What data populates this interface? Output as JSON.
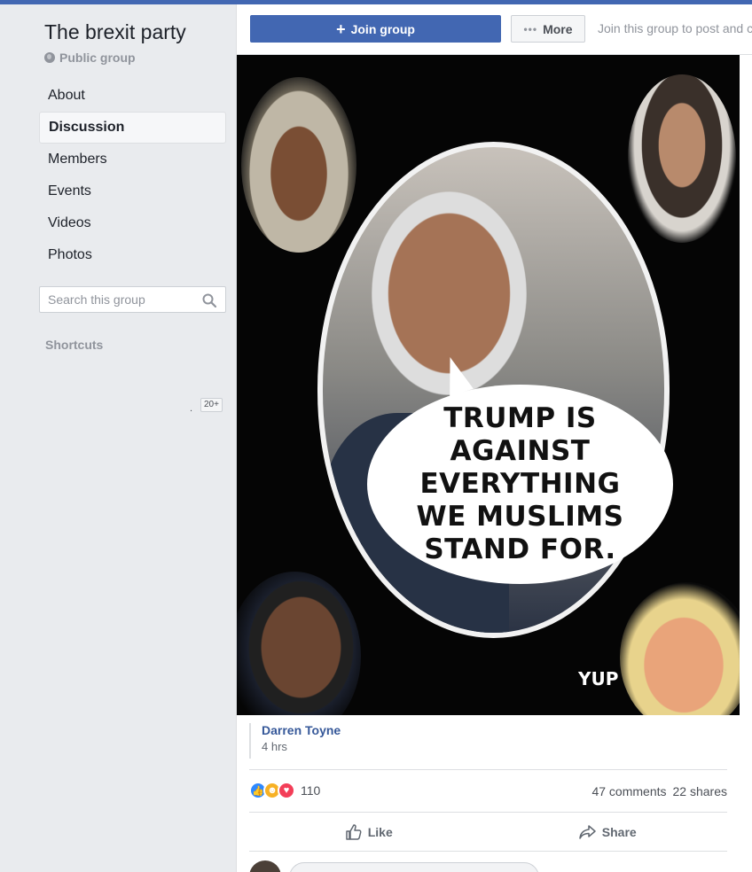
{
  "group": {
    "title": "The brexit party",
    "type": "Public group"
  },
  "nav": {
    "items": [
      {
        "label": "About"
      },
      {
        "label": "Discussion"
      },
      {
        "label": "Members"
      },
      {
        "label": "Events"
      },
      {
        "label": "Videos"
      },
      {
        "label": "Photos"
      }
    ],
    "active": "Discussion"
  },
  "search": {
    "placeholder": "Search this group"
  },
  "shortcuts": {
    "title": "Shortcuts",
    "dot": ".",
    "badge": "20+"
  },
  "action_bar": {
    "join_label": "Join group",
    "more_label": "More",
    "hint": "Join this group to post and c"
  },
  "post": {
    "image_text": "TRUMP IS AGAINST EVERYTHING WE MUSLIMS STAND FOR.",
    "image_sign": "YUP",
    "author": "Darren Toyne",
    "time": "4 hrs",
    "reactions_count": "110",
    "comments": "47 comments",
    "shares": "22 shares",
    "like_label": "Like",
    "share_label": "Share"
  },
  "icons": {
    "globe": "globe-icon",
    "search": "search-icon",
    "plus": "plus-icon",
    "more": "ellipsis-icon",
    "like": "thumbs-up-icon",
    "share": "share-arrow-icon"
  },
  "colors": {
    "brand": "#4267b2",
    "link": "#365899",
    "like_reaction": "#2e89ff",
    "haha_reaction": "#f7b125",
    "love_reaction": "#f33e58"
  }
}
